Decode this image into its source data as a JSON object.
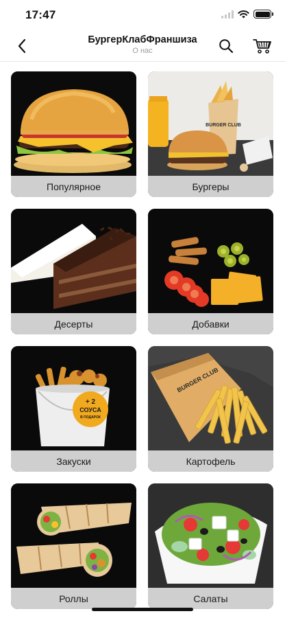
{
  "status_bar": {
    "time": "17:47"
  },
  "header": {
    "title": "БургерКлабФраншиза",
    "subtitle": "О нас"
  },
  "categories": [
    {
      "label": "Популярное"
    },
    {
      "label": "Бургеры"
    },
    {
      "label": "Десерты"
    },
    {
      "label": "Добавки"
    },
    {
      "label": "Закуски"
    },
    {
      "label": "Картофель"
    },
    {
      "label": "Роллы"
    },
    {
      "label": "Салаты"
    }
  ],
  "images": {
    "burger_box_brand": "BURGER CLUB",
    "bucket_promo_line1": "+ 2",
    "bucket_promo_line2": "СОУСА",
    "bucket_promo_line3": "В ПОДАРОК",
    "fries_brand": "BURGER CLUB"
  },
  "colors": {
    "label_bg": "#cfcfcf",
    "card_bg": "#0d0d0d",
    "divider": "#e4e4e4",
    "subtitle": "#9a9a9a"
  }
}
